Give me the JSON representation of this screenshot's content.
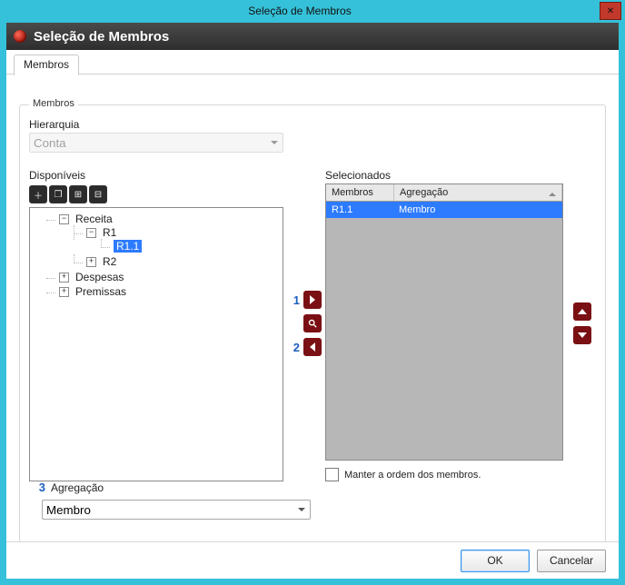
{
  "window": {
    "title": "Seleção de Membros"
  },
  "header": {
    "title": "Seleção de Membros"
  },
  "tabs": [
    {
      "label": "Membros"
    }
  ],
  "fieldset": {
    "legend": "Membros"
  },
  "hierarchy": {
    "label": "Hierarquia",
    "value": "Conta"
  },
  "available": {
    "label": "Disponíveis",
    "tree": {
      "root": "Receita",
      "r1": "R1",
      "r11": "R1.1",
      "r2": "R2",
      "despesas": "Despesas",
      "premissas": "Premissas"
    }
  },
  "selected": {
    "label": "Selecionados",
    "columns": {
      "members": "Membros",
      "aggregation": "Agregação"
    },
    "rows": [
      {
        "member": "R1.1",
        "aggregation": "Membro"
      }
    ]
  },
  "callouts": {
    "add": "1",
    "remove": "2",
    "agg": "3"
  },
  "keepOrder": {
    "label": "Manter a ordem dos membros."
  },
  "aggregation": {
    "label": "Agregação",
    "value": "Membro"
  },
  "footer": {
    "ok": "OK",
    "cancel": "Cancelar"
  }
}
